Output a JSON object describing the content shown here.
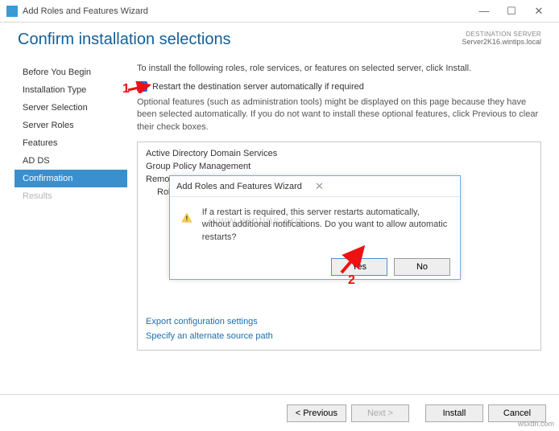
{
  "titlebar": {
    "title": "Add Roles and Features Wizard"
  },
  "header": {
    "title": "Confirm installation selections",
    "dest_label": "DESTINATION SERVER",
    "dest_value": "Server2K16.wintips.local"
  },
  "sidebar": {
    "items": [
      {
        "label": "Before You Begin"
      },
      {
        "label": "Installation Type"
      },
      {
        "label": "Server Selection"
      },
      {
        "label": "Server Roles"
      },
      {
        "label": "Features"
      },
      {
        "label": "AD DS"
      },
      {
        "label": "Confirmation"
      },
      {
        "label": "Results"
      }
    ]
  },
  "main": {
    "intro": "To install the following roles, role services, or features on selected server, click Install.",
    "checkbox_label": "Restart the destination server automatically if required",
    "optional_text": "Optional features (such as administration tools) might be displayed on this page because they have been selected automatically. If you do not want to install these optional features, click Previous to clear their check boxes.",
    "list": {
      "i0": "Active Directory Domain Services",
      "i1": "Group Policy Management",
      "i2": "Remote Server Administration Tools",
      "i3": "Role Administration Tools"
    },
    "link_export": "Export configuration settings",
    "link_alt": "Specify an alternate source path"
  },
  "dialog": {
    "title": "Add Roles and Features Wizard",
    "message": "If a restart is required, this server restarts automatically, without additional notifications. Do you want to allow automatic restarts?",
    "yes": "Yes",
    "no": "No"
  },
  "footer": {
    "prev": "< Previous",
    "next": "Next >",
    "install": "Install",
    "cancel": "Cancel"
  },
  "annot": {
    "one": "1",
    "two": "2"
  },
  "watermark": "www.wintips.org",
  "wsxdn": "wsxdn.com"
}
